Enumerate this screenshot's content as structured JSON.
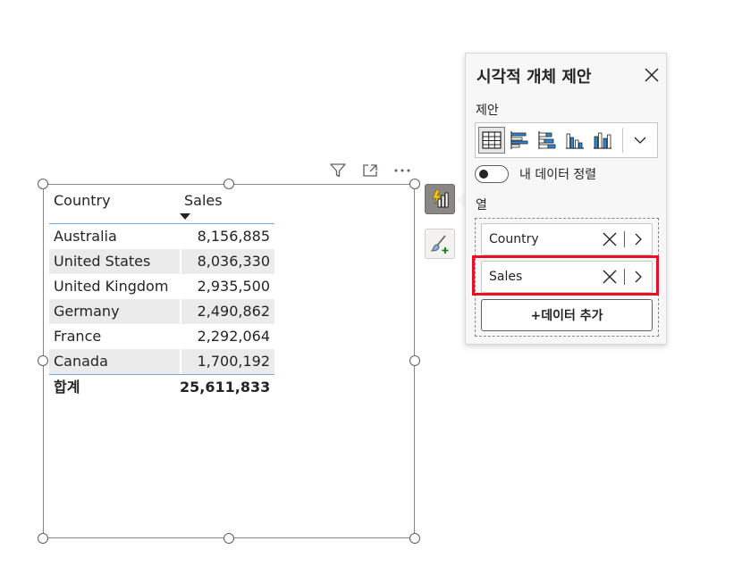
{
  "visual_header": {
    "icons": [
      "filter-icon",
      "focus-mode-icon",
      "more-options-icon"
    ]
  },
  "table": {
    "columns": [
      "Country",
      "Sales"
    ],
    "sorted_column": "Sales",
    "sort_direction": "descending",
    "rows": [
      {
        "country": "Australia",
        "sales": "8,156,885"
      },
      {
        "country": "United States",
        "sales": "8,036,330"
      },
      {
        "country": "United Kingdom",
        "sales": "2,935,500"
      },
      {
        "country": "Germany",
        "sales": "2,490,862"
      },
      {
        "country": "France",
        "sales": "2,292,064"
      },
      {
        "country": "Canada",
        "sales": "1,700,192"
      }
    ],
    "total_label": "합계",
    "total_value": "25,611,833"
  },
  "side_buttons": {
    "suggest_icon": "visual-suggestion-icon",
    "format_icon": "format-visual-icon"
  },
  "panel": {
    "title": "시각적 개체 제안",
    "suggest_label": "제안",
    "chart_types": [
      "table-icon",
      "clustered-bar-icon",
      "stacked-bar-icon",
      "column-chart-icon",
      "clustered-column-icon"
    ],
    "selected_chart_type": "table-icon",
    "toggle_label": "내 데이터 정렬",
    "toggle_on": false,
    "columns_label": "열",
    "fields": [
      "Country",
      "Sales"
    ],
    "add_data_label": "+데이터 추가"
  },
  "colors": {
    "highlight": "#e81123",
    "table_rule": "#7ba6dd",
    "alt_row": "#ebebeb",
    "chart_icon_blue": "#2b88d8"
  }
}
